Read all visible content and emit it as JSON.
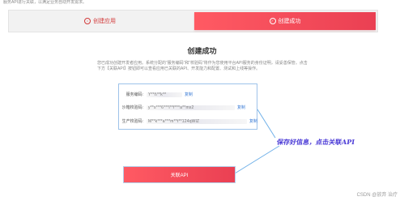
{
  "top_note": "服务API进行关联，以满足业务自动开发需求。",
  "steps": [
    {
      "label": "创建应用",
      "icon": "circle-icon"
    },
    {
      "label": "创建成功",
      "icon": "check-circle-icon",
      "active": true
    }
  ],
  "title": "创建成功",
  "description": "您已成功创建开发者应用。系统分配的“服务编码”和“校验码”将作为您使用平台API服务的身份证明，请妥善保管。点击下方【关联API】按钮即可以查看应用已关联的API、开发能力和配置、测试和上线等操作。",
  "fields": [
    {
      "label": "服务编码:",
      "value": "Y**t\\**k**",
      "copy": "复制"
    },
    {
      "label": "沙箱校验码:",
      "value": "y**s***6***l**f***a**mx2",
      "copy": "复制"
    },
    {
      "label": "生产校验码:",
      "value": "M**k***a***m**t**124qWlZ",
      "copy": "复制"
    }
  ],
  "annotation": "保存好信息，点击关联API",
  "associate_button": "关联API",
  "watermark": "CSDN @放弃    治疗",
  "colors": {
    "accent": "#ea4053",
    "link": "#3a7bd5",
    "annotation": "#4a3ad6"
  }
}
